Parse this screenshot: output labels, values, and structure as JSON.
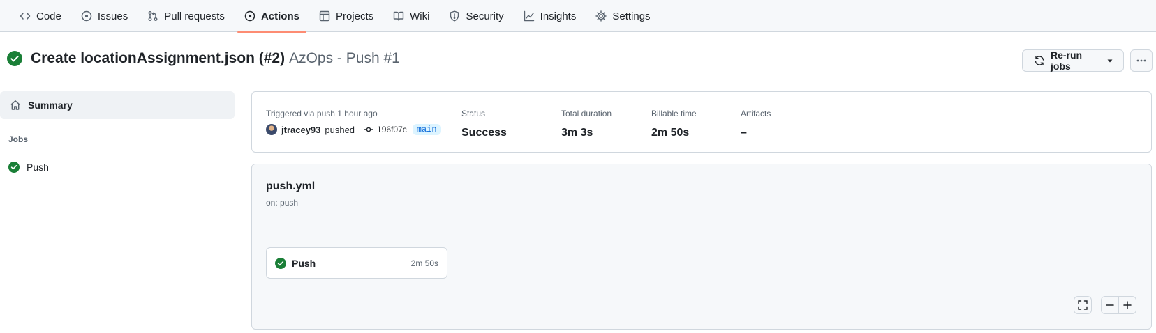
{
  "nav": {
    "tabs": [
      {
        "label": "Code",
        "icon": "code-icon"
      },
      {
        "label": "Issues",
        "icon": "issue-opened-icon"
      },
      {
        "label": "Pull requests",
        "icon": "git-pull-request-icon"
      },
      {
        "label": "Actions",
        "icon": "play-icon",
        "active": true
      },
      {
        "label": "Projects",
        "icon": "table-icon"
      },
      {
        "label": "Wiki",
        "icon": "book-icon"
      },
      {
        "label": "Security",
        "icon": "shield-icon"
      },
      {
        "label": "Insights",
        "icon": "graph-icon"
      },
      {
        "label": "Settings",
        "icon": "gear-icon"
      }
    ]
  },
  "run": {
    "title": "Create locationAssignment.json (#2)",
    "subtitle": "AzOps - Push #1",
    "status_icon": "check-circle-fill-icon",
    "rerun_label": "Re-run jobs"
  },
  "sidebar": {
    "summary_label": "Summary",
    "jobs_heading": "Jobs",
    "jobs": [
      {
        "label": "Push",
        "status": "success"
      }
    ]
  },
  "summary": {
    "triggered": "Triggered via push 1 hour ago",
    "user": "jtracey93",
    "verb": "pushed",
    "commit": "196f07c",
    "branch": "main",
    "status_label": "Status",
    "status_value": "Success",
    "duration_label": "Total duration",
    "duration_value": "3m 3s",
    "billable_label": "Billable time",
    "billable_value": "2m 50s",
    "artifacts_label": "Artifacts",
    "artifacts_value": "–"
  },
  "workflow": {
    "file": "push.yml",
    "trigger": "on: push",
    "job": {
      "name": "Push",
      "duration": "2m 50s"
    }
  },
  "colors": {
    "success": "#1a7f37",
    "accent_underline": "#fd8c73",
    "link": "#0969da",
    "muted": "#59636e",
    "border": "#d0d7de"
  }
}
